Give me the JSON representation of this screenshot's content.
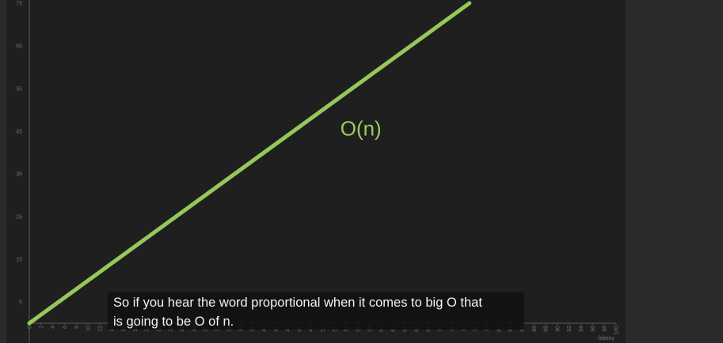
{
  "colors": {
    "curve": "#94c95a",
    "axis": "#5a5a5a",
    "tick_text": "#6f6f6f",
    "panel": "#1f1f1f"
  },
  "chart_data": {
    "type": "line",
    "title": "",
    "xlabel": "",
    "ylabel": "",
    "xlim": [
      0,
      100
    ],
    "ylim": [
      0,
      75
    ],
    "grid": false,
    "y_ticks": [
      "75",
      "65",
      "55",
      "45",
      "35",
      "25",
      "15",
      "5"
    ],
    "x_ticks": [
      "0",
      "2",
      "4",
      "6",
      "8",
      "10",
      "12",
      "14",
      "16",
      "18",
      "20",
      "22",
      "24",
      "26",
      "28",
      "30",
      "32",
      "34",
      "36",
      "38",
      "40",
      "42",
      "44",
      "46",
      "48",
      "50",
      "52",
      "54",
      "56",
      "58",
      "60",
      "62",
      "64",
      "66",
      "68",
      "70",
      "72",
      "74",
      "76",
      "78",
      "80",
      "82",
      "84",
      "86",
      "88",
      "90",
      "92",
      "94",
      "96",
      "98",
      "100"
    ],
    "series": [
      {
        "name": "O(n)",
        "x": [
          0,
          75
        ],
        "y": [
          0,
          75
        ]
      }
    ],
    "annotations": [
      {
        "text": "O(n)",
        "x": 53,
        "y": 44
      }
    ]
  },
  "caption": {
    "line1": "So if you hear the word proportional when it comes to big O that",
    "line2": "is going to be O of n."
  },
  "watermark": "ûdemy"
}
